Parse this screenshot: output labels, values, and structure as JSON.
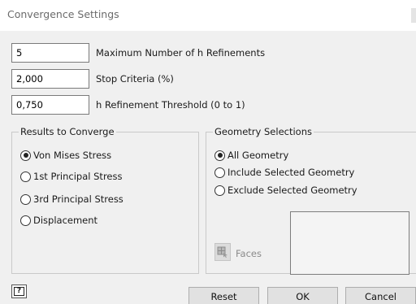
{
  "window": {
    "title": "Convergence Settings"
  },
  "fields": [
    {
      "value": "5",
      "label": "Maximum Number of h Refinements"
    },
    {
      "value": "2,000",
      "label": "Stop Criteria (%)"
    },
    {
      "value": "0,750",
      "label": "h Refinement Threshold (0 to 1)"
    }
  ],
  "results_group": {
    "title": "Results to Converge",
    "options": [
      {
        "label": "Von Mises Stress",
        "selected": true
      },
      {
        "label": "1st Principal Stress",
        "selected": false
      },
      {
        "label": "3rd Principal Stress",
        "selected": false
      },
      {
        "label": "Displacement",
        "selected": false
      }
    ]
  },
  "geometry_group": {
    "title": "Geometry Selections",
    "options": [
      {
        "label": "All Geometry",
        "selected": true
      },
      {
        "label": "Include Selected Geometry",
        "selected": false
      },
      {
        "label": "Exclude Selected Geometry",
        "selected": false
      }
    ],
    "faces_label": "Faces",
    "faces_icon": "faces-select-icon"
  },
  "footer": {
    "help_icon": "help-icon",
    "help_glyph": "?",
    "reset_label": "Reset",
    "ok_label": "OK",
    "cancel_label": "Cancel"
  }
}
